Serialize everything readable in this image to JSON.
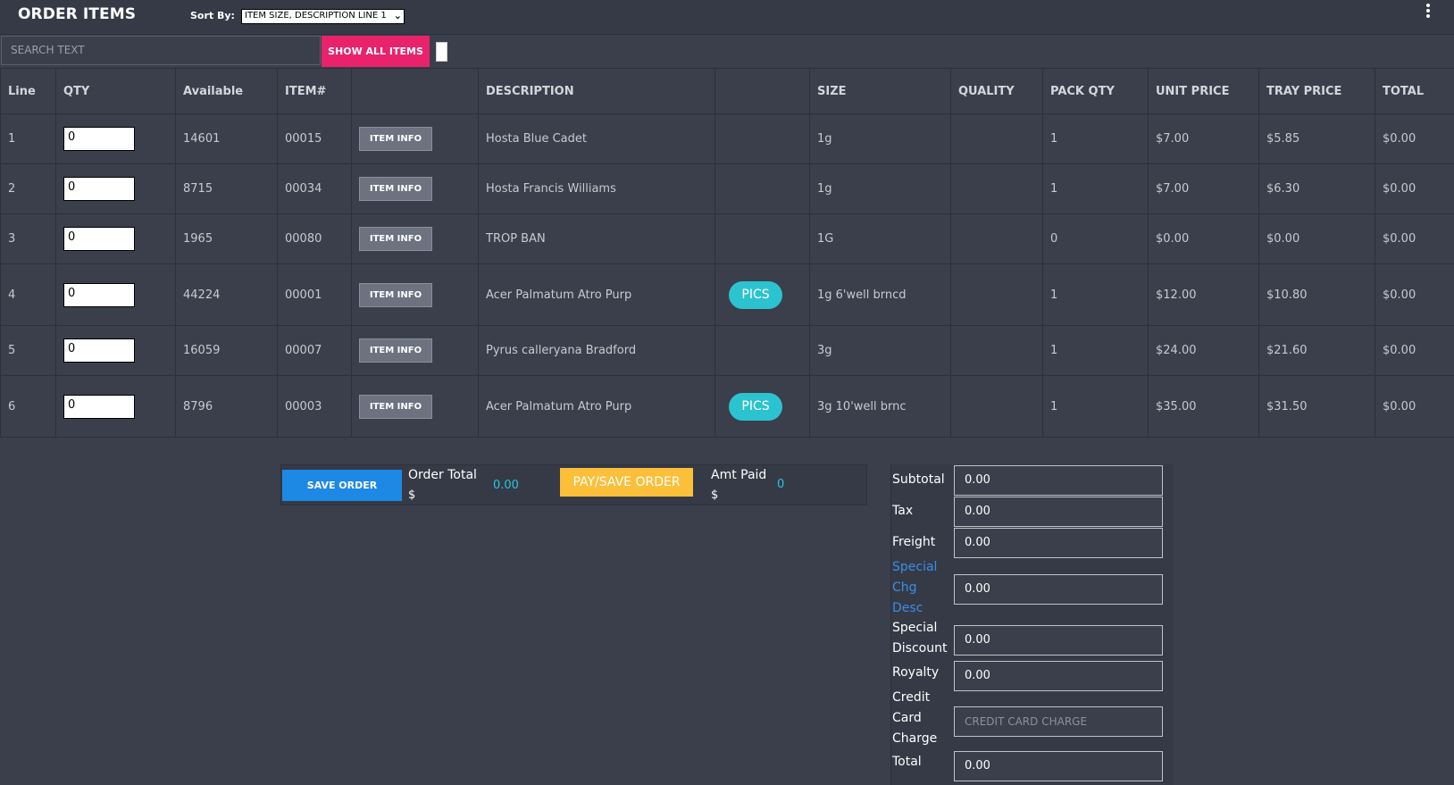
{
  "header": {
    "title": "ORDER ITEMS",
    "sort_label": "Sort By:",
    "sort_value": "ITEM SIZE, DESCRIPTION LINE 1",
    "menu_icon": "kebab-menu-icon"
  },
  "search": {
    "placeholder": "SEARCH TEXT",
    "show_all_label": "SHOW ALL ITEMS"
  },
  "table": {
    "columns": [
      "Line",
      "QTY",
      "Available",
      "ITEM#",
      "",
      "DESCRIPTION",
      "",
      "SIZE",
      "QUALITY",
      "PACK QTY",
      "UNIT PRICE",
      "TRAY PRICE",
      "TOTAL"
    ],
    "item_info_label": "ITEM INFO",
    "pics_label": "PICS",
    "rows": [
      {
        "line": "1",
        "qty": "0",
        "available": "14601",
        "item": "00015",
        "description": "Hosta Blue Cadet",
        "pics": false,
        "size": "1g",
        "quality": "",
        "pack_qty": "1",
        "unit_price": "$7.00",
        "tray_price": "$5.85",
        "total": "$0.00"
      },
      {
        "line": "2",
        "qty": "0",
        "available": "8715",
        "item": "00034",
        "description": "Hosta Francis Williams",
        "pics": false,
        "size": "1g",
        "quality": "",
        "pack_qty": "1",
        "unit_price": "$7.00",
        "tray_price": "$6.30",
        "total": "$0.00"
      },
      {
        "line": "3",
        "qty": "0",
        "available": "1965",
        "item": "00080",
        "description": "TROP BAN",
        "pics": false,
        "size": "1G",
        "quality": "",
        "pack_qty": "0",
        "unit_price": "$0.00",
        "tray_price": "$0.00",
        "total": "$0.00"
      },
      {
        "line": "4",
        "qty": "0",
        "available": "44224",
        "item": "00001",
        "description": "Acer Palmatum Atro Purp",
        "pics": true,
        "size": "1g 6'well brncd",
        "quality": "",
        "pack_qty": "1",
        "unit_price": "$12.00",
        "tray_price": "$10.80",
        "total": "$0.00"
      },
      {
        "line": "5",
        "qty": "0",
        "available": "16059",
        "item": "00007",
        "description": "Pyrus calleryana Bradford",
        "pics": false,
        "size": "3g",
        "quality": "",
        "pack_qty": "1",
        "unit_price": "$24.00",
        "tray_price": "$21.60",
        "total": "$0.00"
      },
      {
        "line": "6",
        "qty": "0",
        "available": "8796",
        "item": "00003",
        "description": "Acer Palmatum Atro Purp",
        "pics": true,
        "size": "3g 10'well brnc",
        "quality": "",
        "pack_qty": "1",
        "unit_price": "$35.00",
        "tray_price": "$31.50",
        "total": "$0.00"
      }
    ]
  },
  "order_bar": {
    "save_label": "SAVE ORDER",
    "order_total_label": "Order Total",
    "currency": "$",
    "order_total_value": "0.00",
    "pay_label": "PAY/SAVE ORDER",
    "amt_paid_label": "Amt Paid",
    "amt_paid_value": "0"
  },
  "totals": {
    "subtotal_label": "Subtotal",
    "subtotal": "0.00",
    "tax_label": "Tax",
    "tax": "0.00",
    "freight_label": "Freight",
    "freight": "0.00",
    "special_chg_label_1": "Special",
    "special_chg_label_2": "Chg",
    "special_chg_label_3": "Desc",
    "special_chg": "0.00",
    "special_discount_label_1": "Special",
    "special_discount_label_2": "Discount",
    "special_discount": "0.00",
    "royalty_label": "Royalty",
    "royalty": "0.00",
    "cc_label_1": "Credit",
    "cc_label_2": "Card",
    "cc_label_3": "Charge",
    "cc_placeholder": "CREDIT CARD CHARGE",
    "total_label": "Total",
    "total": "0.00"
  },
  "colors": {
    "background": "#3a3f4b",
    "accent_pink": "#e8236b",
    "save_blue": "#1e88e5",
    "pay_yellow": "#fbbf3a",
    "pics_teal": "#2cc3d0"
  }
}
